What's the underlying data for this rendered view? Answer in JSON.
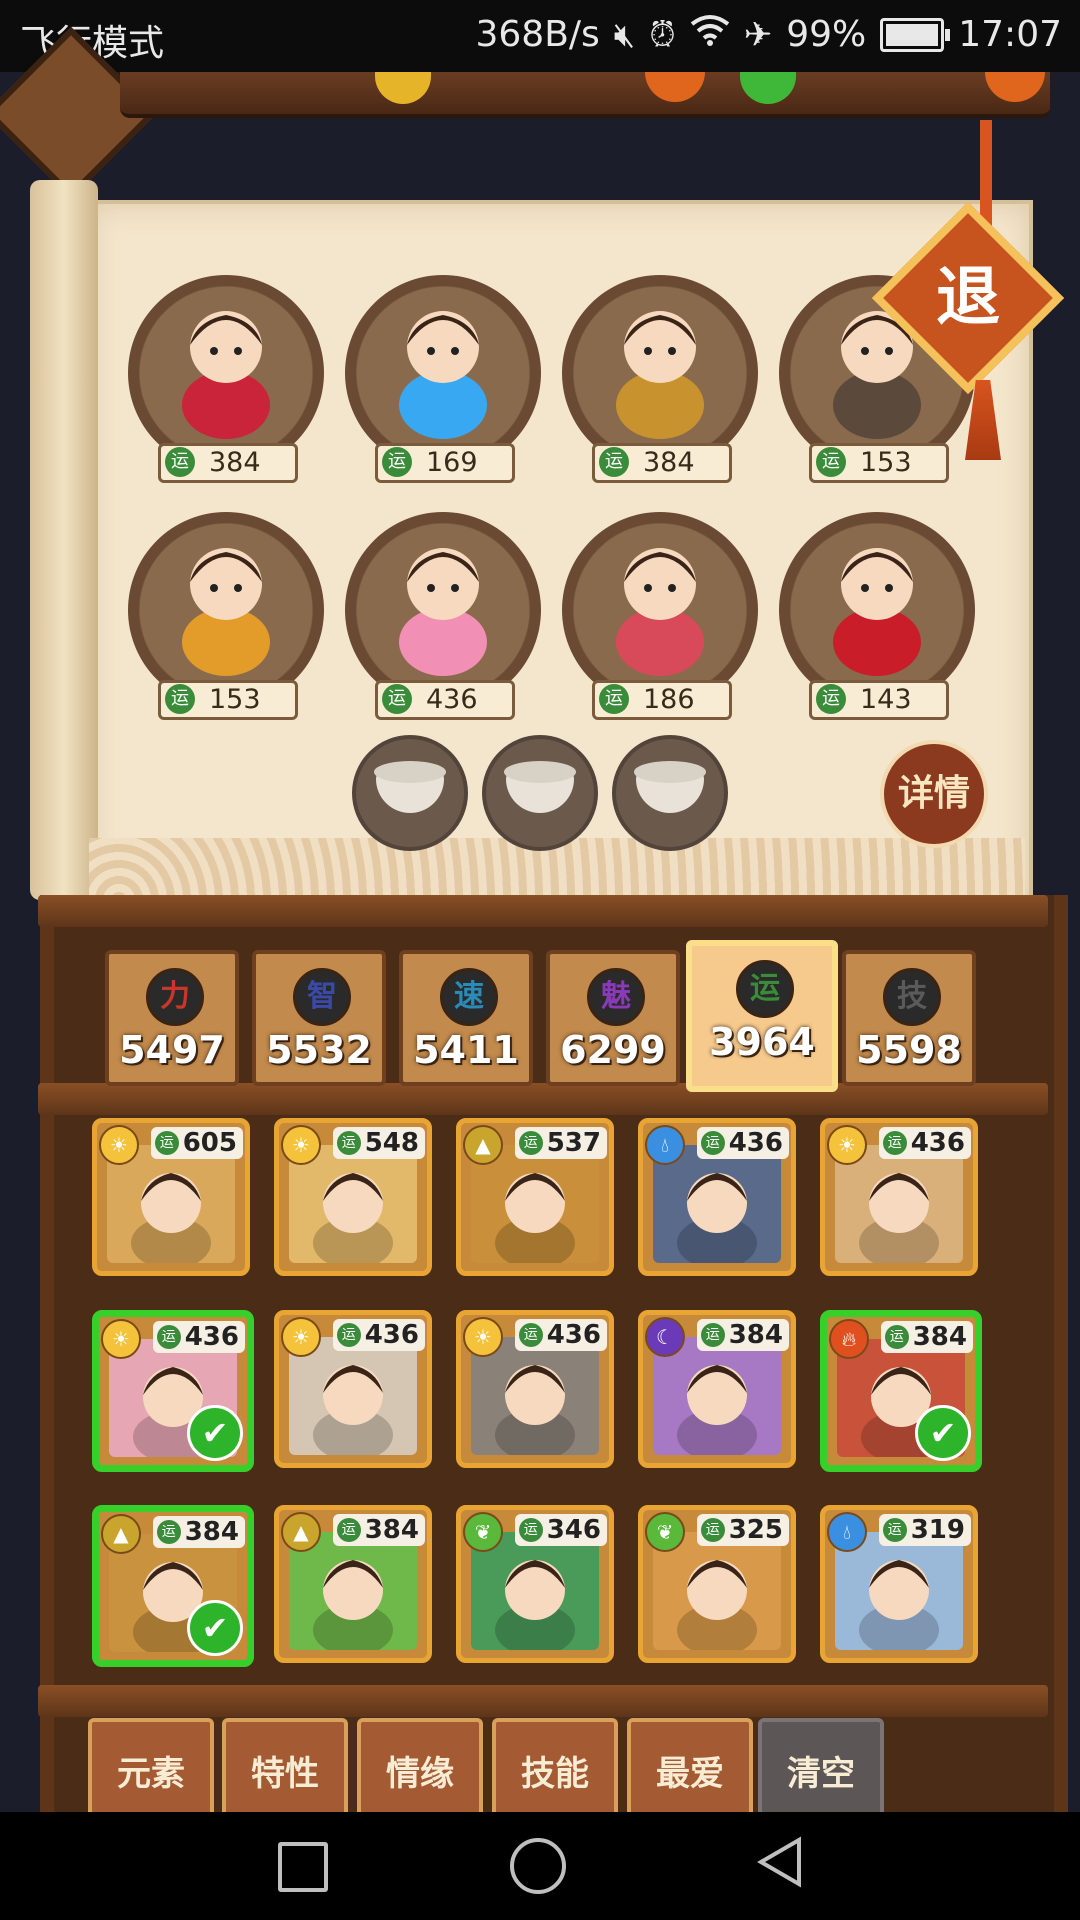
{
  "status_bar": {
    "mode_text": "飞行模式",
    "net_speed": "368B/s",
    "battery_pct": "99%",
    "battery_level": 0.99,
    "time": "17:07",
    "icons": [
      "mute-icon",
      "alarm-icon",
      "wifi-icon",
      "airplane-icon",
      "battery-icon"
    ]
  },
  "roster": {
    "exit_label": "退",
    "detail_label": "详情",
    "luck_icon_label": "运",
    "slots": [
      {
        "name": "crown-princess",
        "luck": "384",
        "color": "#c9243a"
      },
      {
        "name": "blue-dragon-girl",
        "luck": "169",
        "color": "#39a8f2"
      },
      {
        "name": "leaf-hat-girl",
        "luck": "384",
        "color": "#c8922e"
      },
      {
        "name": "water-jar-spirit",
        "luck": "153",
        "color": "#5b4a3c"
      },
      {
        "name": "honey-pot-boy",
        "luck": "153",
        "color": "#e39b2a"
      },
      {
        "name": "pink-coin-girl",
        "luck": "436",
        "color": "#f28fb4"
      },
      {
        "name": "birthday-cake-girl",
        "luck": "186",
        "color": "#d84a5a"
      },
      {
        "name": "red-coat-girl",
        "luck": "143",
        "color": "#c91d2a"
      }
    ],
    "bowls": [
      {
        "name": "rice-bowl-1"
      },
      {
        "name": "rice-bowl-2"
      },
      {
        "name": "rice-bowl-3"
      }
    ]
  },
  "stats": [
    {
      "key": "power",
      "glyph": "力",
      "value": "5497",
      "color": "#c8372a",
      "selected": false
    },
    {
      "key": "wisdom",
      "glyph": "智",
      "value": "5532",
      "color": "#3b4aa8",
      "selected": false
    },
    {
      "key": "speed",
      "glyph": "速",
      "value": "5411",
      "color": "#2a8ab8",
      "selected": false
    },
    {
      "key": "charm",
      "glyph": "魅",
      "value": "6299",
      "color": "#8a3ab8",
      "selected": false
    },
    {
      "key": "luck",
      "glyph": "运",
      "value": "3964",
      "color": "#3a8c3a",
      "selected": true
    },
    {
      "key": "skill",
      "glyph": "技",
      "value": "5598",
      "color": "#5a5a5a",
      "selected": false
    }
  ],
  "cards": [
    {
      "name": "card-pumpkin-girl",
      "luck": "605",
      "elem": "sun",
      "elem_color": "#f5c33b",
      "bg": "#d9a85a",
      "selected": false
    },
    {
      "name": "card-roast-duck",
      "luck": "548",
      "elem": "sun",
      "elem_color": "#f5c33b",
      "bg": "#e2b86a",
      "selected": false
    },
    {
      "name": "card-golden-goddess",
      "luck": "537",
      "elem": "earth",
      "elem_color": "#c9a52e",
      "bg": "#c98f3a",
      "selected": false
    },
    {
      "name": "card-blue-beast",
      "luck": "436",
      "elem": "water",
      "elem_color": "#3b8fe0",
      "bg": "#5a6a8a",
      "selected": false
    },
    {
      "name": "card-white-fighter",
      "luck": "436",
      "elem": "sun",
      "elem_color": "#f5c33b",
      "bg": "#d9b07a",
      "selected": false
    },
    {
      "name": "card-pink-coin-girl",
      "luck": "436",
      "elem": "sun",
      "elem_color": "#f5c33b",
      "bg": "#e7a6b4",
      "selected": true
    },
    {
      "name": "card-white-rabbit",
      "luck": "436",
      "elem": "sun",
      "elem_color": "#f5c33b",
      "bg": "#d4c6b2",
      "selected": false
    },
    {
      "name": "card-tombstone",
      "luck": "436",
      "elem": "sun",
      "elem_color": "#f5c33b",
      "bg": "#8a8278",
      "selected": false
    },
    {
      "name": "card-purple-cauldron",
      "luck": "384",
      "elem": "moon",
      "elem_color": "#6a3ab8",
      "bg": "#a779c4",
      "selected": false
    },
    {
      "name": "card-crown-princess",
      "luck": "384",
      "elem": "fire",
      "elem_color": "#e0501e",
      "bg": "#c9523a",
      "selected": true
    },
    {
      "name": "card-leaf-hat-girl",
      "luck": "384",
      "elem": "earth",
      "elem_color": "#c9a52e",
      "bg": "#c8923e",
      "selected": true
    },
    {
      "name": "card-watermelon-kid",
      "luck": "384",
      "elem": "earth",
      "elem_color": "#c9a52e",
      "bg": "#6fb84a",
      "selected": false
    },
    {
      "name": "card-green-dragon",
      "luck": "346",
      "elem": "wood",
      "elem_color": "#5ab83a",
      "bg": "#4a9a5a",
      "selected": false
    },
    {
      "name": "card-coin-girl",
      "luck": "325",
      "elem": "wood",
      "elem_color": "#5ab83a",
      "bg": "#d89a4a",
      "selected": false
    },
    {
      "name": "card-ski-cat",
      "luck": "319",
      "elem": "water",
      "elem_color": "#3b8fe0",
      "bg": "#9ab8d8",
      "selected": false
    }
  ],
  "tabs": [
    {
      "name": "tab-element",
      "label": "元素"
    },
    {
      "name": "tab-trait",
      "label": "特性"
    },
    {
      "name": "tab-bond",
      "label": "情缘"
    },
    {
      "name": "tab-skill",
      "label": "技能"
    },
    {
      "name": "tab-favorite",
      "label": "最爱"
    },
    {
      "name": "tab-clear",
      "label": "清空"
    }
  ]
}
